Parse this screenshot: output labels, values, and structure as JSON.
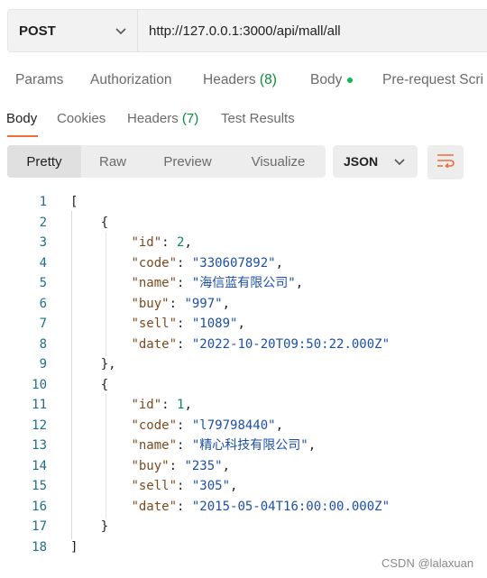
{
  "request": {
    "method": "POST",
    "url": "http://127.0.0.1:3000/api/mall/all"
  },
  "request_tabs": {
    "params": "Params",
    "authorization": "Authorization",
    "headers": "Headers",
    "headers_count": "(8)",
    "body": "Body",
    "prerequest": "Pre-request Scri"
  },
  "response_tabs": {
    "body": "Body",
    "cookies": "Cookies",
    "headers": "Headers",
    "headers_count": "(7)",
    "test_results": "Test Results"
  },
  "view_modes": {
    "pretty": "Pretty",
    "raw": "Raw",
    "preview": "Preview",
    "visualize": "Visualize"
  },
  "format": "JSON",
  "code_lines": [
    {
      "n": "1",
      "html": "<span class=\"punc\">[</span>"
    },
    {
      "n": "2",
      "html": "    <span class=\"punc\">{</span>"
    },
    {
      "n": "3",
      "html": "        <span class=\"key\">\"id\"</span><span class=\"punc\">: </span><span class=\"num\">2</span><span class=\"punc\">,</span>"
    },
    {
      "n": "4",
      "html": "        <span class=\"key\">\"code\"</span><span class=\"punc\">: </span><span class=\"str\">\"330607892\"</span><span class=\"punc\">,</span>"
    },
    {
      "n": "5",
      "html": "        <span class=\"key\">\"name\"</span><span class=\"punc\">: </span><span class=\"str\">\"海信蓝有限公司\"</span><span class=\"punc\">,</span>"
    },
    {
      "n": "6",
      "html": "        <span class=\"key\">\"buy\"</span><span class=\"punc\">: </span><span class=\"str\">\"997\"</span><span class=\"punc\">,</span>"
    },
    {
      "n": "7",
      "html": "        <span class=\"key\">\"sell\"</span><span class=\"punc\">: </span><span class=\"str\">\"1089\"</span><span class=\"punc\">,</span>"
    },
    {
      "n": "8",
      "html": "        <span class=\"key\">\"date\"</span><span class=\"punc\">: </span><span class=\"str\">\"2022-10-20T09:50:22.000Z\"</span>"
    },
    {
      "n": "9",
      "html": "    <span class=\"punc\">},</span>"
    },
    {
      "n": "10",
      "html": "    <span class=\"punc\">{</span>"
    },
    {
      "n": "11",
      "html": "        <span class=\"key\">\"id\"</span><span class=\"punc\">: </span><span class=\"num\">1</span><span class=\"punc\">,</span>"
    },
    {
      "n": "12",
      "html": "        <span class=\"key\">\"code\"</span><span class=\"punc\">: </span><span class=\"str\">\"l79798440\"</span><span class=\"punc\">,</span>"
    },
    {
      "n": "13",
      "html": "        <span class=\"key\">\"name\"</span><span class=\"punc\">: </span><span class=\"str\">\"精心科技有限公司\"</span><span class=\"punc\">,</span>"
    },
    {
      "n": "14",
      "html": "        <span class=\"key\">\"buy\"</span><span class=\"punc\">: </span><span class=\"str\">\"235\"</span><span class=\"punc\">,</span>"
    },
    {
      "n": "15",
      "html": "        <span class=\"key\">\"sell\"</span><span class=\"punc\">: </span><span class=\"str\">\"305\"</span><span class=\"punc\">,</span>"
    },
    {
      "n": "16",
      "html": "        <span class=\"key\">\"date\"</span><span class=\"punc\">: </span><span class=\"str\">\"2015-05-04T16:00:00.000Z\"</span>"
    },
    {
      "n": "17",
      "html": "    <span class=\"punc\">}</span>"
    },
    {
      "n": "18",
      "html": "<span class=\"punc\">]</span>"
    }
  ],
  "watermark": "CSDN @lalaxuan",
  "icons": {
    "method_dropdown": "chevron-down-icon",
    "format_dropdown": "chevron-down-icon",
    "wrap": "wrap-lines-icon"
  },
  "colors": {
    "accent": "#f26b3a",
    "count_green": "#0a8a3a",
    "dot_green": "#0cbb52"
  }
}
